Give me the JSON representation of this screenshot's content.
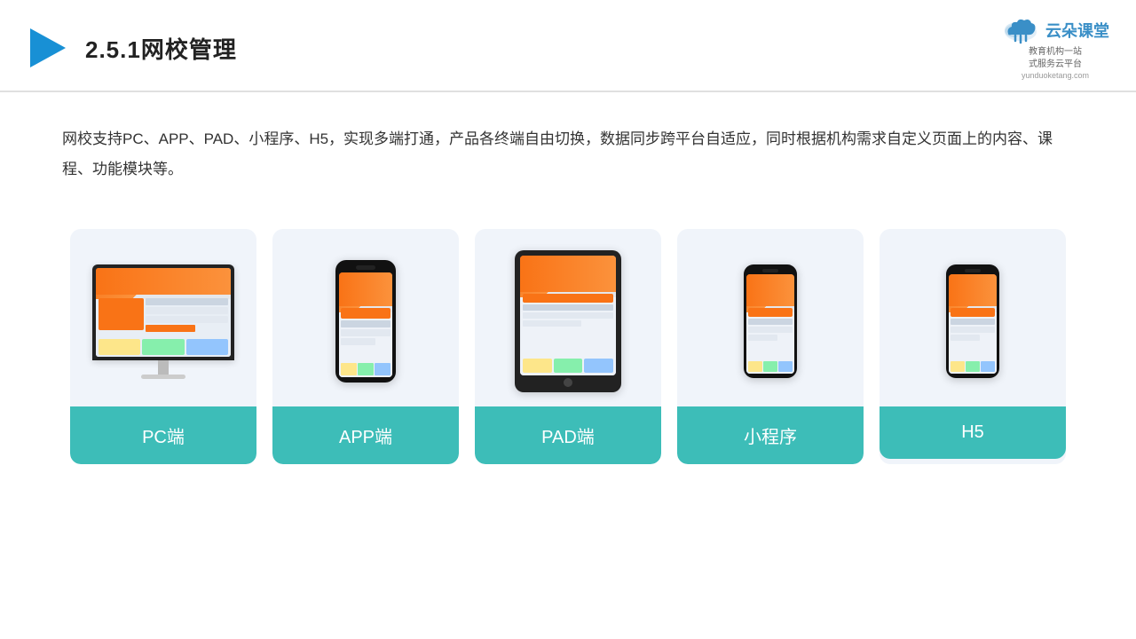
{
  "header": {
    "title": "2.5.1网校管理",
    "logo_name": "云朵课堂",
    "logo_url": "yunduoketang.com",
    "logo_sub1": "教育机构一站",
    "logo_sub2": "式服务云平台"
  },
  "description": {
    "text": "网校支持PC、APP、PAD、小程序、H5，实现多端打通，产品各终端自由切换，数据同步跨平台自适应，同时根据机构需求自定义页面上的内容、课程、功能模块等。"
  },
  "cards": [
    {
      "id": "pc",
      "label": "PC端"
    },
    {
      "id": "app",
      "label": "APP端"
    },
    {
      "id": "pad",
      "label": "PAD端"
    },
    {
      "id": "miniprogram",
      "label": "小程序"
    },
    {
      "id": "h5",
      "label": "H5"
    }
  ]
}
